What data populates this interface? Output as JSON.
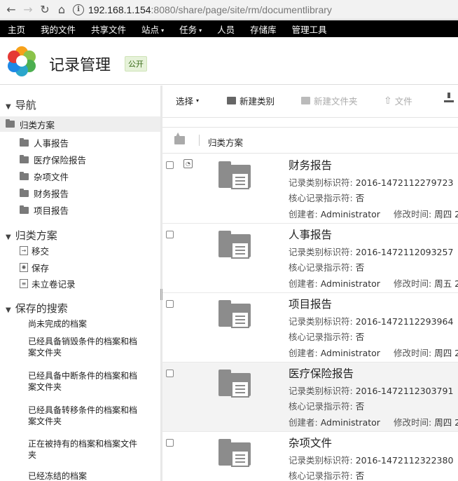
{
  "browser": {
    "url_host": "192.168.1.154",
    "url_rest": ":8080/share/page/site/rm/documentlibrary"
  },
  "app_nav": {
    "items": [
      "主页",
      "我的文件",
      "共享文件",
      "站点",
      "任务",
      "人员",
      "存储库",
      "管理工具"
    ],
    "dropdown_marker": "▾"
  },
  "site": {
    "title": "记录管理",
    "visibility": "公开"
  },
  "sidebar": {
    "nav_heading": "导航",
    "root": "归类方案",
    "folders": [
      "人事报告",
      "医疗保险报告",
      "杂项文件",
      "财务报告",
      "项目报告"
    ],
    "plan_heading": "归类方案",
    "plan_items": [
      "移交",
      "保存",
      "未立卷记录"
    ],
    "saved_heading": "保存的搜索",
    "saved_searches": [
      "尚未完成的档案",
      "已经具备销毁条件的档案和档案文件夹",
      "已经具备中断条件的档案和档案文件夹",
      "已经具备转移条件的档案和档案文件夹",
      "正在被持有的档案和档案文件夹",
      "已经冻结的档案"
    ]
  },
  "toolbar": {
    "select": "选择",
    "new_category": "新建类别",
    "new_folder": "新建文件夹",
    "file": "文件"
  },
  "breadcrumb": {
    "current": "归类方案"
  },
  "labels": {
    "category_id": "记录类别标识符:",
    "core_indicator": "核心记录指示符:",
    "creator": "创建者:",
    "modified": "修改时间:"
  },
  "documents": [
    {
      "title": "财务报告",
      "category_id": "2016-1472112279723",
      "core": "否",
      "creator": "Administrator",
      "modified": "周四 2"
    },
    {
      "title": "人事报告",
      "category_id": "2016-1472112093257",
      "core": "否",
      "creator": "Administrator",
      "modified": "周五 2"
    },
    {
      "title": "项目报告",
      "category_id": "2016-1472112293964",
      "core": "否",
      "creator": "Administrator",
      "modified": "周四 2"
    },
    {
      "title": "医疗保险报告",
      "category_id": "2016-1472112303791",
      "core": "否",
      "creator": "Administrator",
      "modified": "周四 2"
    },
    {
      "title": "杂项文件",
      "category_id": "2016-1472112322380",
      "core": "否",
      "creator": "",
      "modified": ""
    }
  ]
}
